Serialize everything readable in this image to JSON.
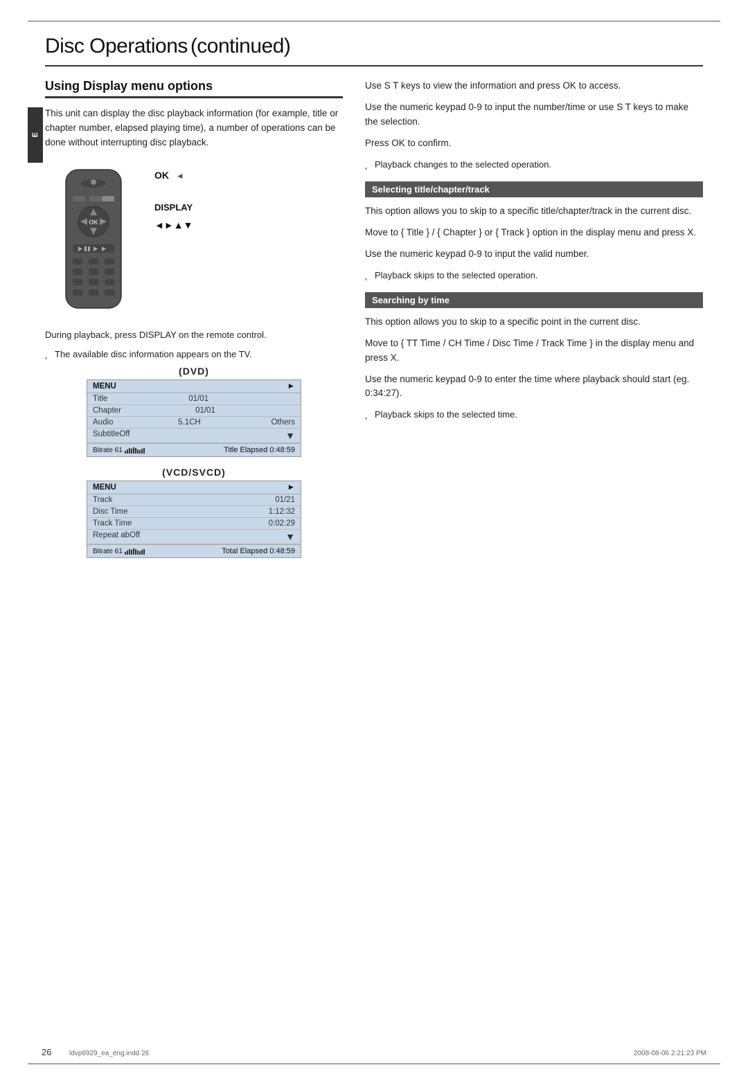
{
  "page": {
    "title": "Disc Operations",
    "continued": "(continued)",
    "page_number": "26",
    "footer_left": "ldvp6929_ea_eng.indd  26",
    "footer_right": "2008-08-06  2:21:23 PM",
    "side_tab": "E"
  },
  "left_col": {
    "section_heading": "Using Display menu options",
    "intro_text": "This unit can display the disc playback information (for example, title or chapter number, elapsed playing time), a number of operations can be done without interrupting disc playback.",
    "ok_label": "OK",
    "display_label": "DISPLAY",
    "arrows_label": "◄►▲▼",
    "during_playback_text": "During playback, press DISPLAY  on the remote control.",
    "bullet1": "The available disc information appears on the TV.",
    "dvd_label": "(DVD)",
    "dvd_panel": {
      "menu_label": "MENU",
      "menu_arrow": "►",
      "rows": [
        {
          "label": "Title",
          "value": "01/01",
          "extra": ""
        },
        {
          "label": "Chapter",
          "value": "01/01",
          "extra": ""
        },
        {
          "label": "Audio",
          "value": "5.1CH",
          "extra": "Others"
        },
        {
          "label": "Subtitle",
          "value": "Off",
          "extra": ""
        }
      ],
      "footer_bitrate": "Bitrate  61",
      "footer_elapsed": "Title Elapsed   0:48:59",
      "scroll_arrow": "▼"
    },
    "vcdsvcd_label": "(VCD/SVCD)",
    "vcdsvcd_panel": {
      "menu_label": "MENU",
      "menu_arrow": "►",
      "rows": [
        {
          "label": "Track",
          "value": "01/21",
          "extra": ""
        },
        {
          "label": "Disc  Time",
          "value": "1:12:32",
          "extra": ""
        },
        {
          "label": "Track  Time",
          "value": "0:02:29",
          "extra": ""
        },
        {
          "label": "Repeat ab",
          "value": "Off",
          "extra": ""
        }
      ],
      "footer_bitrate": "Bitrate  61",
      "footer_elapsed": "Total Elapsed   0:48:59",
      "scroll_arrow": "▼"
    }
  },
  "right_col": {
    "use_st_keys_text": "Use  S T  keys to view the information and press OK  to access.",
    "use_numeric_text": "Use the numeric keypad 0-9   to input the number/time or use  S T  keys to make the selection.",
    "press_ok_text": "Press OK  to confirm.",
    "bullet_playback": "Playback changes to the selected operation.",
    "section1": {
      "heading": "Selecting title/chapter/track",
      "para1": "This option allows you to skip to a specific title/chapter/track in the current disc.",
      "para2": "Move to { Title } / { Chapter } or { Track } option in the display menu and press  X.",
      "para3": "Use the numeric keypad 0-9   to input the valid number.",
      "bullet1": "Playback skips to the selected operation."
    },
    "section2": {
      "heading": "Searching by time",
      "para1": "This option allows you to skip to a specific point in the current disc.",
      "para2": "Move to { TT Time / CH Time / Disc Time / Track Time } in the display menu and press  X.",
      "para3": "Use the numeric keypad 0-9   to enter the time where playback should start (eg. 0:34:27).",
      "bullet1": "Playback skips to the selected time."
    }
  }
}
